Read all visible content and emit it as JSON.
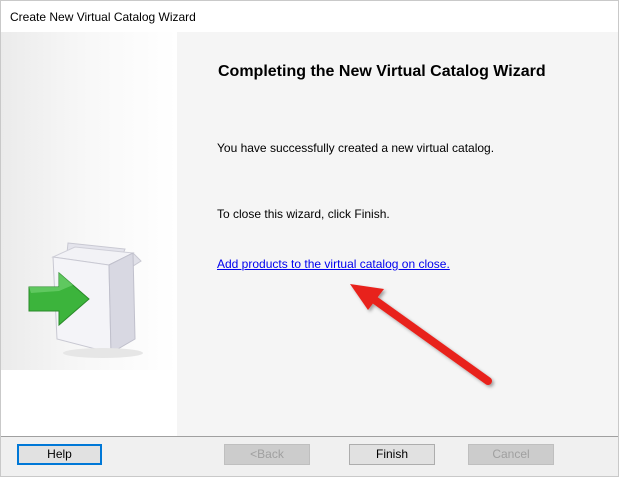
{
  "window": {
    "title": "Create New Virtual Catalog Wizard"
  },
  "main": {
    "heading": "Completing the New Virtual Catalog Wizard",
    "success_message": "You have successfully created a new virtual catalog.",
    "close_instruction": "To close this wizard, click Finish.",
    "add_products_link": "Add products to the virtual catalog on close."
  },
  "buttons": {
    "help": "Help",
    "back": "<Back",
    "finish": "Finish",
    "cancel": "Cancel"
  },
  "annotation": {
    "arrow_color": "#e8231d"
  },
  "icons": {
    "wizard_image": "box-with-green-arrow-icon"
  },
  "colors": {
    "link": "#0000ee",
    "default_button_border": "#0078d7"
  }
}
